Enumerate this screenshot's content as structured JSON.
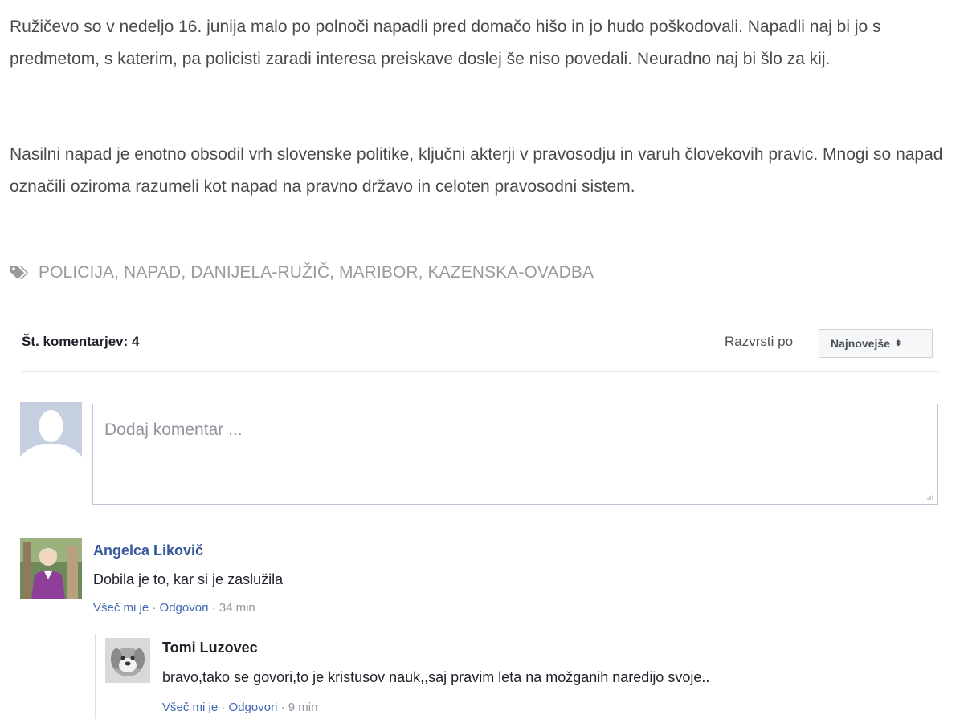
{
  "article": {
    "paragraph1": "Ružičevo so v nedeljo 16. junija malo po polnoči napadli pred domačo hišo in jo hudo poškodovali. Napadli naj bi jo s predmetom, s katerim, pa policisti zaradi interesa preiskave doslej še niso povedali. Neuradno naj bi šlo za kij.",
    "paragraph2": "Nasilni napad je enotno obsodil vrh slovenske politike, ključni akterji v pravosodju in varuh človekovih pravic. Mnogi so napad označili oziroma razumeli kot napad na pravno državo in celoten pravosodni sistem.",
    "tags": "POLICIJA, NAPAD, DANIJELA-RUŽIČ, MARIBOR, KAZENSKA-OVADBA",
    "tag_icon": "tag-icon"
  },
  "comments_plugin": {
    "count_label": "Št. komentarjev: 4",
    "sort_label": "Razvrsti po",
    "sort_value": "Najnovejše",
    "composer_placeholder": "Dodaj komentar ...",
    "like_label": "Všeč mi je",
    "separator": "·",
    "reply_label": "Odgovori",
    "colors": {
      "link": "#4267b2",
      "name": "#365899",
      "meta": "#90949c"
    },
    "comments": [
      {
        "author": "Angelca Likovič",
        "text": "Dobila je to, kar si je zaslužila",
        "time": "34 min",
        "replies": [
          {
            "author": "Tomi Luzovec",
            "text": "bravo,tako se govori,to je kristusov nauk,,saj pravim leta na možganih naredijo svoje..",
            "time": "9 min"
          }
        ]
      }
    ]
  }
}
